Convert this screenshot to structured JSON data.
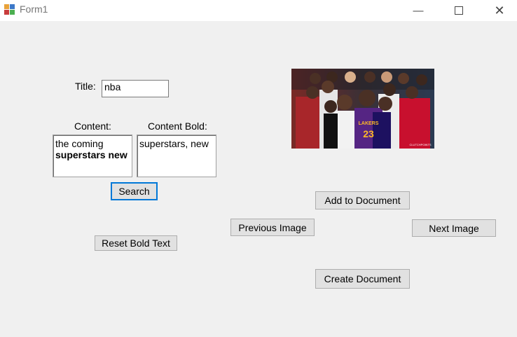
{
  "window": {
    "title": "Form1"
  },
  "form": {
    "title_label": "Title:",
    "title_value": "nba",
    "content_label": "Content:",
    "content_line1": "the coming",
    "content_line2": "superstars new",
    "content_bold_label": "Content Bold:",
    "content_bold_value": "superstars, new",
    "search_label": "Search",
    "reset_bold_label": "Reset Bold Text"
  },
  "image_panel": {
    "watermark": "CLUTCHPOINTS",
    "jersey_text": "LAKERS",
    "jersey_number": "23",
    "add_to_document_label": "Add to Document",
    "previous_image_label": "Previous Image",
    "next_image_label": "Next Image",
    "create_document_label": "Create Document"
  }
}
